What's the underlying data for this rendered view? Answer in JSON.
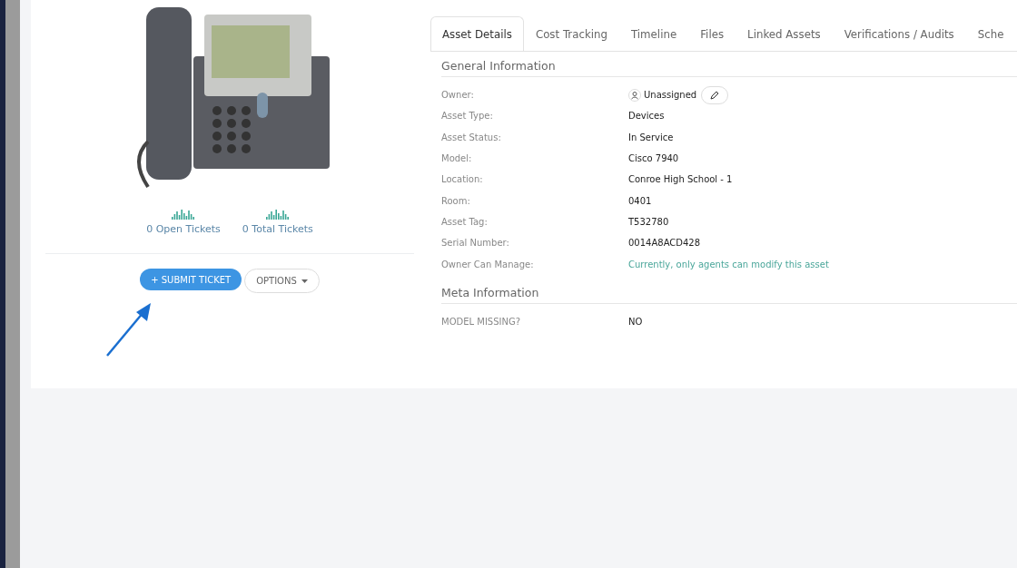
{
  "stats": [
    {
      "label": "0 Open Tickets"
    },
    {
      "label": "0 Total Tickets"
    }
  ],
  "actions": {
    "primary": "+ SUBMIT TICKET",
    "options": "OPTIONS"
  },
  "tabs": [
    {
      "label": "Asset Details",
      "selected": true
    },
    {
      "label": "Cost Tracking",
      "selected": false
    },
    {
      "label": "Timeline",
      "selected": false
    },
    {
      "label": "Files",
      "selected": false
    },
    {
      "label": "Linked Assets",
      "selected": false
    },
    {
      "label": "Verifications / Audits",
      "selected": false
    },
    {
      "label": "Sche",
      "selected": false
    }
  ],
  "sections": [
    {
      "title": "General Information",
      "rows": [
        {
          "label": "Owner:",
          "value": "Unassigned",
          "kind": "owner"
        },
        {
          "label": "Asset Type:",
          "value": "Devices",
          "kind": "text"
        },
        {
          "label": "Asset Status:",
          "value": "In Service",
          "kind": "text"
        },
        {
          "label": "Model:",
          "value": "Cisco 7940",
          "kind": "text"
        },
        {
          "label": "Location:",
          "value": "Conroe High School - 1",
          "kind": "text"
        },
        {
          "label": "Room:",
          "value": "0401",
          "kind": "text"
        },
        {
          "label": "Asset Tag:",
          "value": "T532780",
          "kind": "text"
        },
        {
          "label": "Serial Number:",
          "value": "0014A8ACD428",
          "kind": "text"
        },
        {
          "label": "Owner Can Manage:",
          "value": "Currently, only agents can modify this asset",
          "kind": "note"
        }
      ]
    },
    {
      "title": "Meta Information",
      "rows": [
        {
          "label": "MODEL MISSING?",
          "value": "NO",
          "kind": "text"
        }
      ]
    }
  ]
}
